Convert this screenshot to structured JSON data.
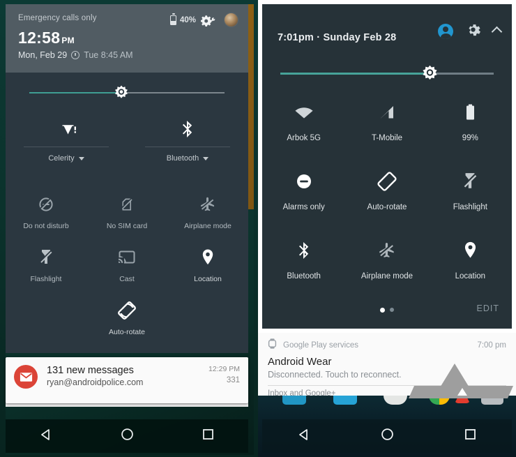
{
  "left_phone": {
    "status": {
      "carrier": "Emergency calls only",
      "battery_percent": "40%",
      "battery_icon": "battery-icon",
      "settings_icon": "gear-wrench-icon",
      "avatar_icon": "user-avatar"
    },
    "clock": {
      "time": "12:58",
      "ampm": "PM",
      "date": "Mon, Feb 29",
      "alarm_icon": "alarm-clock-icon",
      "alarm": "Tue 8:45 AM"
    },
    "brightness": {
      "icon": "brightness-sun-icon",
      "value_percent": 36
    },
    "big_tiles": [
      {
        "icon": "wifi-icon",
        "label": "Celerity",
        "caret": "chevron-down-icon"
      },
      {
        "icon": "bluetooth-icon",
        "label": "Bluetooth",
        "caret": "chevron-down-icon"
      }
    ],
    "tiles": [
      {
        "icon": "do-not-disturb-icon",
        "label": "Do not disturb",
        "state": "off"
      },
      {
        "icon": "no-sim-card-icon",
        "label": "No SIM card",
        "state": "off"
      },
      {
        "icon": "airplane-mode-off-icon",
        "label": "Airplane mode",
        "state": "off"
      },
      {
        "icon": "flashlight-off-icon",
        "label": "Flashlight",
        "state": "off"
      },
      {
        "icon": "cast-icon",
        "label": "Cast",
        "state": "off"
      },
      {
        "icon": "location-icon",
        "label": "Location",
        "state": "on"
      },
      {
        "icon": "auto-rotate-icon",
        "label": "Auto-rotate",
        "state": "on"
      }
    ],
    "notification": {
      "icon": "gmail-icon",
      "title": "131 new messages",
      "subtitle": "ryan@androidpolice.com",
      "time": "12:29 PM",
      "count": "331"
    },
    "navbar": [
      {
        "icon": "back-triangle-icon"
      },
      {
        "icon": "home-circle-icon"
      },
      {
        "icon": "recents-square-icon"
      }
    ]
  },
  "right_phone": {
    "header": {
      "datetime": "7:01pm · Sunday Feb 28",
      "user_icon": "user-account-icon",
      "settings_icon": "gear-icon",
      "collapse_icon": "chevron-up-icon"
    },
    "brightness": {
      "icon": "brightness-sun-icon",
      "value_percent": 60
    },
    "tiles": [
      {
        "icon": "wifi-icon",
        "label": "Arbok 5G",
        "state": "on"
      },
      {
        "icon": "cell-signal-icon",
        "label": "T-Mobile",
        "state": "on"
      },
      {
        "icon": "battery-full-icon",
        "label": "99%",
        "state": "on"
      },
      {
        "icon": "alarms-only-icon",
        "label": "Alarms only",
        "state": "on"
      },
      {
        "icon": "auto-rotate-icon",
        "label": "Auto-rotate",
        "state": "on"
      },
      {
        "icon": "flashlight-off-icon",
        "label": "Flashlight",
        "state": "off"
      },
      {
        "icon": "bluetooth-icon",
        "label": "Bluetooth",
        "state": "on"
      },
      {
        "icon": "airplane-mode-off-icon",
        "label": "Airplane mode",
        "state": "off"
      },
      {
        "icon": "location-icon",
        "label": "Location",
        "state": "on"
      }
    ],
    "footer": {
      "page_dots": 2,
      "active_dot": 1,
      "edit_label": "EDIT"
    },
    "notification": {
      "app_icon": "android-wear-watch-icon",
      "app_name": "Google Play services",
      "time": "7:00 pm",
      "title": "Android Wear",
      "text": "Disconnected. Touch to reconnect.",
      "more": "Inbox and Google+"
    },
    "navbar": [
      {
        "icon": "back-triangle-icon"
      },
      {
        "icon": "home-circle-icon"
      },
      {
        "icon": "recents-square-icon"
      }
    ]
  },
  "colors": {
    "left_shade_bg": "#2b3740",
    "left_status_bg": "#515c63",
    "right_shade_bg": "#263238",
    "brightness_fill": "#47a399",
    "accent_blue": "#2196cf",
    "gmail_red": "#db4437"
  }
}
